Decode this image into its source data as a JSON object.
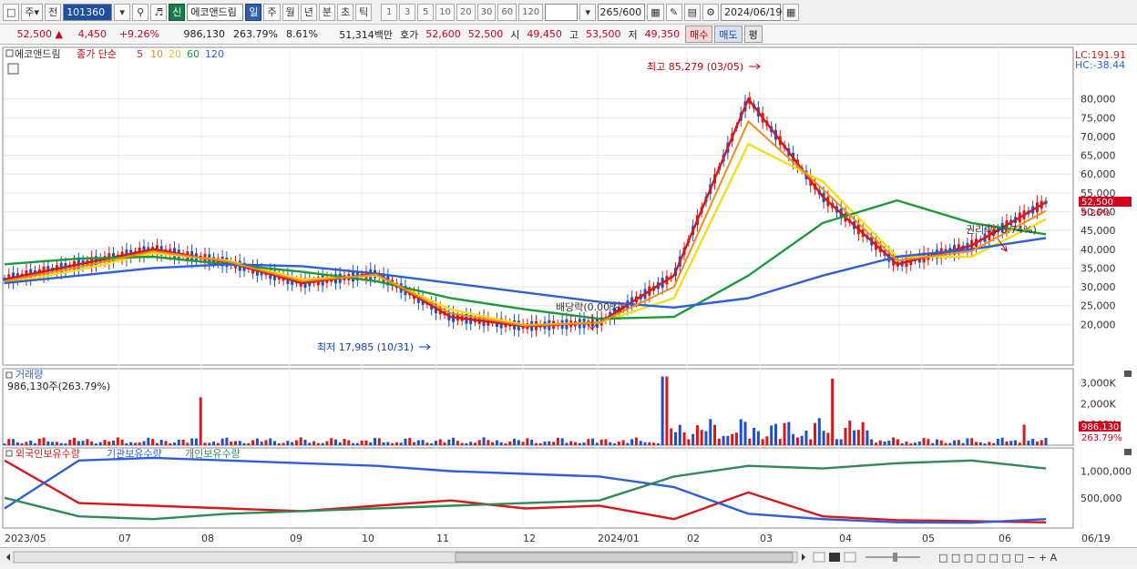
{
  "toolbar": {
    "period_select": "주",
    "all_label": "전",
    "stock_code": "101360",
    "new_badge": "신",
    "stock_name": "에코앤드림",
    "period_tabs": [
      "일",
      "주",
      "월",
      "년",
      "분",
      "초",
      "틱"
    ],
    "active_period": "일",
    "intervals": [
      "1",
      "3",
      "5",
      "10",
      "20",
      "30",
      "60",
      "120"
    ],
    "count_value": "265",
    "count_total": "/600",
    "date": "2024/06/19"
  },
  "quote": {
    "price": "52,500",
    "change": "4,450",
    "change_rate": "+9.26%",
    "volume": "986,130",
    "vol_ratio": "263.79%",
    "turnover_rate": "8.61%",
    "trade_value": "51,314백만",
    "ask_label": "호가",
    "ask1": "52,600",
    "ask2": "52,500",
    "open_label": "시",
    "open": "49,450",
    "high_label": "고",
    "high": "53,500",
    "low_label": "저",
    "low": "49,350",
    "buy_label": "매수",
    "sell_label": "매도",
    "eval_label": "평"
  },
  "price_panel": {
    "legend_name": "에코앤드림",
    "legend_type": "종가 단순",
    "ma_labels": [
      "5",
      "10",
      "20",
      "60",
      "120"
    ],
    "ma_colors": [
      "#d81818",
      "#f08c18",
      "#f0e018",
      "#1a9a3a",
      "#2e5fd8"
    ],
    "lc": "LC:191.91",
    "hc": "HC:-38.44",
    "annotation_high": "최고 85,279 (03/05)",
    "annotation_low": "최저 17,985 (10/31)",
    "annotation_dividend": "배당락(0.00%)",
    "annotation_rights": "권리락(-5.74%)",
    "current_price_tag": "52,500",
    "current_change_tag": "9.26%"
  },
  "volume_panel": {
    "title": "거래량",
    "value": "986,130주(263.79%)",
    "current_tag": "986,130",
    "current_ratio_tag": "263.79%"
  },
  "holding_panel": {
    "series_labels": [
      "외국인보유수량",
      "기관보유수량",
      "개인보유수량"
    ],
    "series_colors": [
      "#d81818",
      "#2e5fd8",
      "#2e8b57"
    ]
  },
  "chart_data": [
    {
      "type": "line",
      "title": "에코앤드림",
      "x_labels": [
        "2023/05",
        "07",
        "08",
        "09",
        "10",
        "11",
        "12",
        "2024/01",
        "02",
        "03",
        "04",
        "05",
        "06",
        "06/19"
      ],
      "ylim": [
        15000,
        85000
      ],
      "y_ticks": [
        "20,000",
        "25,000",
        "30,000",
        "35,000",
        "40,000",
        "45,000",
        "50,000",
        "55,000",
        "60,000",
        "65,000",
        "70,000",
        "75,000",
        "80,000"
      ],
      "x": [
        "2023/05",
        "06",
        "07",
        "08",
        "09",
        "10",
        "11",
        "12",
        "2024/01",
        "02",
        "03",
        "04",
        "05",
        "06",
        "06/19"
      ],
      "series": [
        {
          "name": "5",
          "values": [
            32000,
            36000,
            40000,
            36500,
            31000,
            33500,
            22000,
            19500,
            20500,
            33000,
            80000,
            54000,
            36000,
            41000,
            52500
          ]
        },
        {
          "name": "20",
          "values": [
            31000,
            34500,
            39000,
            37000,
            32000,
            33000,
            24000,
            19800,
            20500,
            27000,
            68000,
            58000,
            38000,
            38000,
            48000
          ]
        },
        {
          "name": "60",
          "values": [
            36000,
            37500,
            38000,
            36000,
            34000,
            31500,
            27000,
            24000,
            21500,
            22000,
            33000,
            47000,
            53000,
            47000,
            44000
          ]
        },
        {
          "name": "120",
          "values": [
            31000,
            33000,
            35000,
            36000,
            35500,
            33500,
            31000,
            28500,
            26000,
            24500,
            27000,
            33000,
            38000,
            40000,
            43000
          ]
        }
      ]
    },
    {
      "type": "bar",
      "title": "거래량",
      "y_ticks": [
        "1,000K",
        "2,000K",
        "3,000K"
      ],
      "ylim": [
        0,
        3500000
      ],
      "values": [
        986130
      ]
    },
    {
      "type": "line",
      "title": "보유수량",
      "y_ticks": [
        "500,000",
        "1,000,000"
      ],
      "series": [
        {
          "name": "외국인보유수량",
          "values": [
            1200000,
            400000,
            350000,
            300000,
            250000,
            350000,
            450000,
            300000,
            350000,
            100000,
            600000,
            150000,
            80000,
            60000,
            40000
          ]
        },
        {
          "name": "기관보유수량",
          "values": [
            300000,
            1200000,
            1250000,
            1200000,
            1150000,
            1100000,
            1000000,
            950000,
            900000,
            700000,
            200000,
            100000,
            40000,
            30000,
            100000
          ]
        },
        {
          "name": "개인보유수량",
          "values": [
            500000,
            150000,
            100000,
            200000,
            250000,
            300000,
            350000,
            400000,
            450000,
            900000,
            1100000,
            1050000,
            1150000,
            1200000,
            1050000
          ]
        }
      ]
    }
  ]
}
